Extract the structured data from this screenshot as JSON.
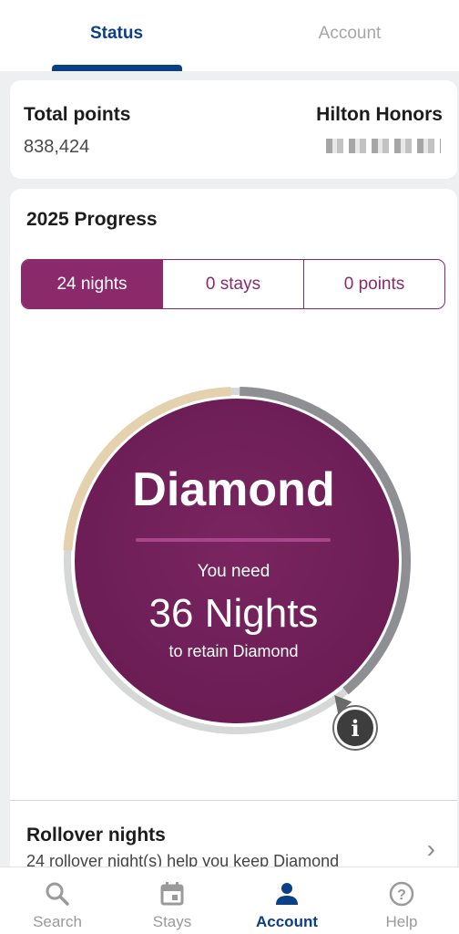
{
  "tabs": {
    "status": "Status",
    "account": "Account"
  },
  "points_card": {
    "title": "Total points",
    "value": "838,424",
    "program": "Hilton Honors"
  },
  "progress": {
    "title": "2025 Progress",
    "segments": [
      "24 nights",
      "0 stays",
      "0 points"
    ],
    "active_segment": 0,
    "tier": "Diamond",
    "need_label": "You need",
    "nights_needed": "36 Nights",
    "retain_label": "to retain Diamond",
    "nights_completed_fraction": 0.4
  },
  "rollover": {
    "title": "Rollover nights",
    "description": "24 rollover night(s) help you keep Diamond"
  },
  "bottom_nav": {
    "search": "Search",
    "stays": "Stays",
    "account": "Account",
    "help": "Help"
  },
  "colors": {
    "brand_blue": "#0b3f86",
    "plum": "#8b2a6b",
    "ring_gold": "#e3d2ad",
    "ring_gray": "#8e8f93"
  }
}
